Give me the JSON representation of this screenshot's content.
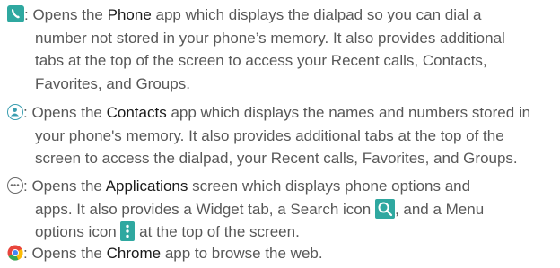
{
  "items": [
    {
      "app": "Phone",
      "icon": "phone-icon",
      "lines": [
        {
          "pre": ": Opens the ",
          "app": "Phone",
          "post": " app which displays the dialpad so you can dial a"
        },
        {
          "text": "number not stored in your phone’s memory. It also provides additional"
        },
        {
          "text": "tabs at the top of the screen to access your Recent calls, Contacts,"
        },
        {
          "text": "Favorites, and Groups."
        }
      ]
    },
    {
      "app": "Contacts",
      "icon": "contacts-icon",
      "lines": [
        {
          "pre": ": Opens the ",
          "app": "Contacts",
          "post": " app which displays the names and numbers stored in"
        },
        {
          "text": "your phone's memory. It also provides additional tabs at the top of the"
        },
        {
          "text": "screen to access the dialpad, your Recent calls, Favorites, and Groups."
        }
      ]
    },
    {
      "app": "Applications",
      "icon": "apps-icon",
      "lines": [
        {
          "pre": ": Opens the ",
          "app": "Applications",
          "post": " screen which displays phone options and"
        },
        {
          "text_before_icon": "apps. It also provides a Widget tab, a Search icon ",
          "inline_icon": "search-icon",
          "text_after_icon": ", and a Menu"
        },
        {
          "text_before_icon": "options icon ",
          "inline_icon": "menu-icon",
          "text_after_icon": " at the top of the screen."
        }
      ]
    },
    {
      "app": "Chrome",
      "icon": "chrome-icon",
      "lines": [
        {
          "pre": ": Opens the ",
          "app": "Chrome",
          "post": " app to browse the web."
        }
      ]
    }
  ],
  "colors": {
    "text": "#585858",
    "emphasis": "#1a1a1a",
    "accent": "#2fa8a0"
  }
}
